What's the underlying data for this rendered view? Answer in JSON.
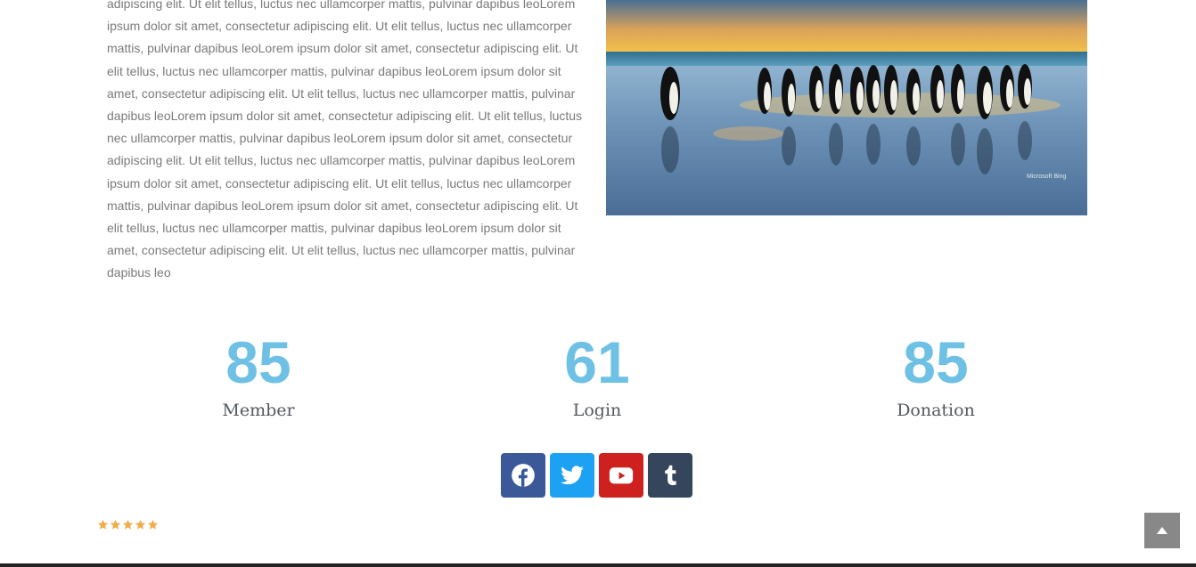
{
  "article": {
    "text": "adipiscing elit. Ut elit tellus, luctus nec ullamcorper mattis, pulvinar dapibus leoLorem ipsum dolor sit amet, consectetur adipiscing elit. Ut elit tellus, luctus nec ullamcorper mattis, pulvinar dapibus leoLorem ipsum dolor sit amet, consectetur adipiscing elit. Ut elit tellus, luctus nec ullamcorper mattis, pulvinar dapibus leoLorem ipsum dolor sit amet, consectetur adipiscing elit. Ut elit tellus, luctus nec ullamcorper mattis, pulvinar dapibus leoLorem ipsum dolor sit amet, consectetur adipiscing elit. Ut elit tellus, luctus nec ullamcorper mattis, pulvinar dapibus leoLorem ipsum dolor sit amet, consectetur adipiscing elit. Ut elit tellus, luctus nec ullamcorper mattis, pulvinar dapibus leoLorem ipsum dolor sit amet, consectetur adipiscing elit. Ut elit tellus, luctus nec ullamcorper mattis, pulvinar dapibus leoLorem ipsum dolor sit amet, consectetur adipiscing elit. Ut elit tellus, luctus nec ullamcorper mattis, pulvinar dapibus leoLorem ipsum dolor sit amet, consectetur adipiscing elit. Ut elit tellus, luctus nec ullamcorper mattis, pulvinar dapibus leo"
  },
  "photo": {
    "watermark": "Microsoft Bing"
  },
  "counters": [
    {
      "number": "85",
      "label": "Member"
    },
    {
      "number": "61",
      "label": "Login"
    },
    {
      "number": "85",
      "label": "Donation"
    }
  ],
  "social": [
    {
      "icon": "facebook-icon",
      "color": "#3b5998"
    },
    {
      "icon": "twitter-icon",
      "color": "#1da1f2"
    },
    {
      "icon": "youtube-icon",
      "color": "#cd201f"
    },
    {
      "icon": "tumblr-icon",
      "color": "#35465c"
    }
  ],
  "rating": {
    "value": 5,
    "max": 5,
    "color": "#f0ad4e"
  },
  "colors": {
    "accent": "#6ec1e4",
    "label": "#54595f",
    "body_text": "#7a7a7a"
  }
}
